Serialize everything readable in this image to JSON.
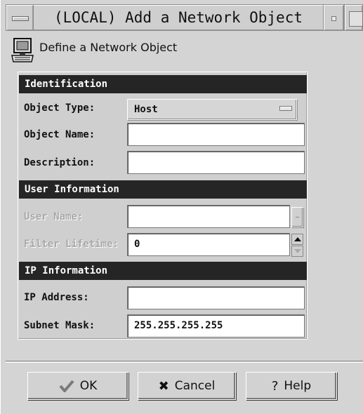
{
  "window": {
    "title": "(LOCAL) Add a Network Object"
  },
  "header": {
    "title": "Define a Network Object",
    "icon": "computer-icon"
  },
  "sections": {
    "identification": "Identification",
    "user_information": "User Information",
    "ip_information": "IP Information"
  },
  "fields": {
    "object_type": {
      "label": "Object Type:",
      "value": "Host"
    },
    "object_name": {
      "label": "Object Name:",
      "value": ""
    },
    "description": {
      "label": "Description:",
      "value": ""
    },
    "user_name": {
      "label": "User Name:",
      "value": "",
      "disabled": true
    },
    "filter_lifetime": {
      "label": "Filter Lifetime:",
      "value": "0",
      "disabled": true
    },
    "ip_address": {
      "label": "IP Address:",
      "value": ""
    },
    "subnet_mask": {
      "label": "Subnet Mask:",
      "value": "255.255.255.255"
    }
  },
  "buttons": {
    "ok": {
      "label": "OK",
      "icon": "checkmark-icon"
    },
    "cancel": {
      "label": "Cancel",
      "icon": "x-icon"
    },
    "help": {
      "label": "Help",
      "icon": "question-icon"
    }
  },
  "colors": {
    "section_header_bg": "#252525",
    "window_bg": "#d4d4d4",
    "ok_check": "#7a7a7a"
  }
}
